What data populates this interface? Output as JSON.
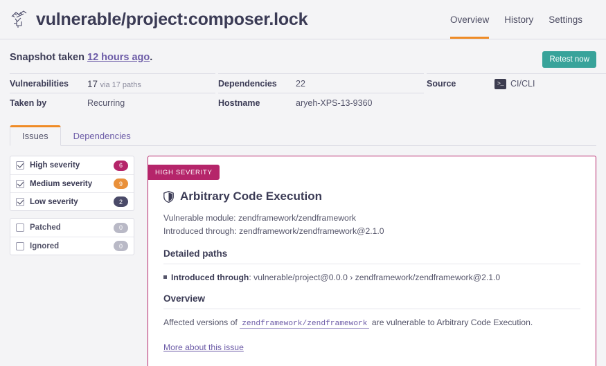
{
  "header": {
    "project_title": "vulnerable/project:composer.lock",
    "logo_icon": "snyk-hand-icon",
    "nav": [
      {
        "label": "Overview",
        "active": true
      },
      {
        "label": "History",
        "active": false
      },
      {
        "label": "Settings",
        "active": false
      }
    ]
  },
  "snapshot": {
    "prefix": "Snapshot taken ",
    "link": "12 hours ago",
    "suffix": ".",
    "retest_label": "Retest now"
  },
  "stats": {
    "col1": [
      {
        "key": "Vulnerabilities",
        "value": "17",
        "sub": "via 17 paths"
      },
      {
        "key": "Taken by",
        "value": "Recurring",
        "sub": ""
      }
    ],
    "col2": [
      {
        "key": "Dependencies",
        "value": "22",
        "sub": ""
      },
      {
        "key": "Hostname",
        "value": "aryeh-XPS-13-9360",
        "sub": ""
      }
    ],
    "col3": [
      {
        "key": "Source",
        "value": "CI/CLI",
        "icon": "terminal-icon",
        "icon_glyph": ">_"
      }
    ]
  },
  "tabs": [
    {
      "label": "Issues",
      "active": true
    },
    {
      "label": "Dependencies",
      "active": false
    }
  ],
  "filters": {
    "severity": [
      {
        "label": "High severity",
        "count": "6",
        "checked": true,
        "color": "#b5256a"
      },
      {
        "label": "Medium severity",
        "count": "9",
        "checked": true,
        "color": "#e9903a"
      },
      {
        "label": "Low severity",
        "count": "2",
        "checked": true,
        "color": "#4a4a68"
      }
    ],
    "status": [
      {
        "label": "Patched",
        "count": "0",
        "checked": false,
        "color": "#b9b9c6"
      },
      {
        "label": "Ignored",
        "count": "0",
        "checked": false,
        "color": "#b9b9c6"
      }
    ]
  },
  "issue": {
    "severity_badge": "HIGH SEVERITY",
    "severity_color": "#b5256a",
    "title_icon": "shield-icon",
    "title": "Arbitrary Code Execution",
    "vulnerable_module_label": "Vulnerable module: ",
    "vulnerable_module": "zendframework/zendframework",
    "introduced_label": "Introduced through: ",
    "introduced_module": "zendframework/zendframework@2.1.0",
    "detailed_paths_heading": "Detailed paths",
    "path_label": "Introduced through",
    "path_sep": ": ",
    "path_value": "vulnerable/project@0.0.0 › zendframework/zendframework@2.1.0",
    "overview_heading": "Overview",
    "overview_prefix": "Affected versions of ",
    "overview_module": "zendframework/zendframework",
    "overview_suffix": " are vulnerable to Arbitrary Code Execution.",
    "more_link": "More about this issue"
  }
}
